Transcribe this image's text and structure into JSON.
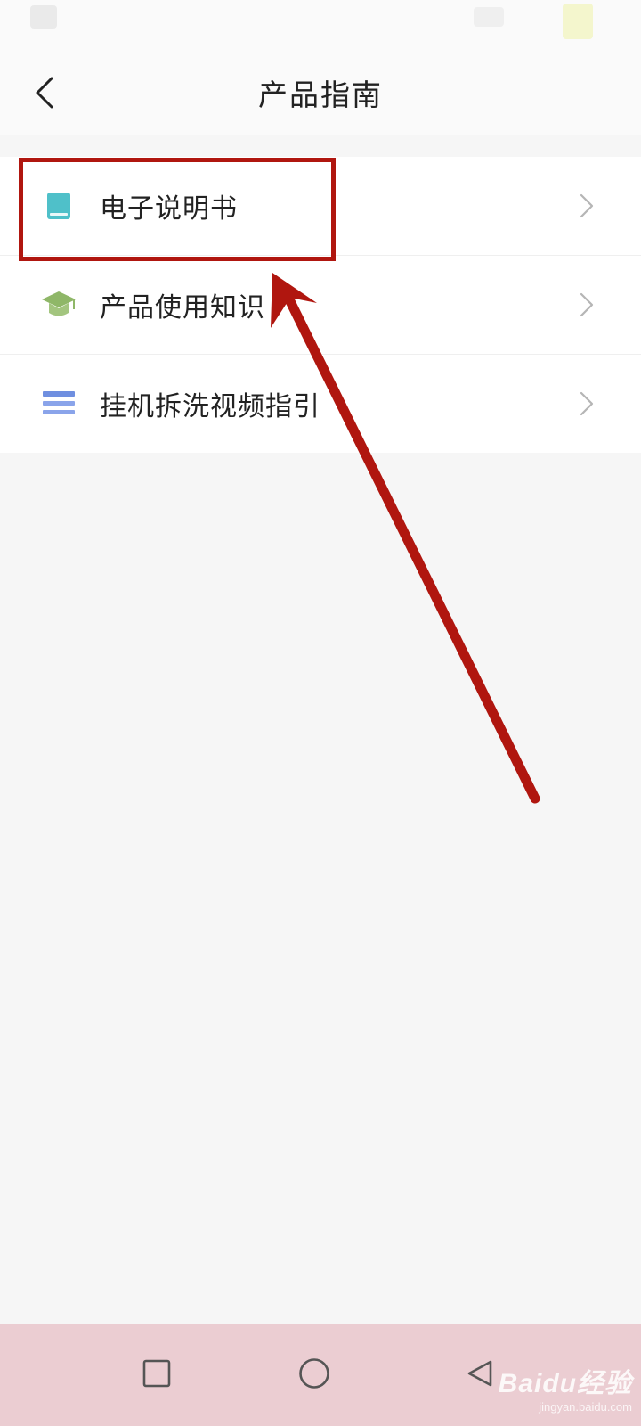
{
  "header": {
    "title": "产品指南"
  },
  "menu": {
    "items": [
      {
        "label": "电子说明书",
        "icon": "book-icon"
      },
      {
        "label": "产品使用知识",
        "icon": "graduation-cap-icon"
      },
      {
        "label": "挂机拆洗视频指引",
        "icon": "list-lines-icon"
      }
    ]
  },
  "colors": {
    "highlight": "#b0160f",
    "book_icon": "#4fc0c9",
    "cap_icon": "#8fb768",
    "list_icon": "#6f8fe0",
    "navbar": "#ebcdd2"
  },
  "watermark": {
    "brand": "Baidu经验",
    "url": "jingyan.baidu.com"
  }
}
